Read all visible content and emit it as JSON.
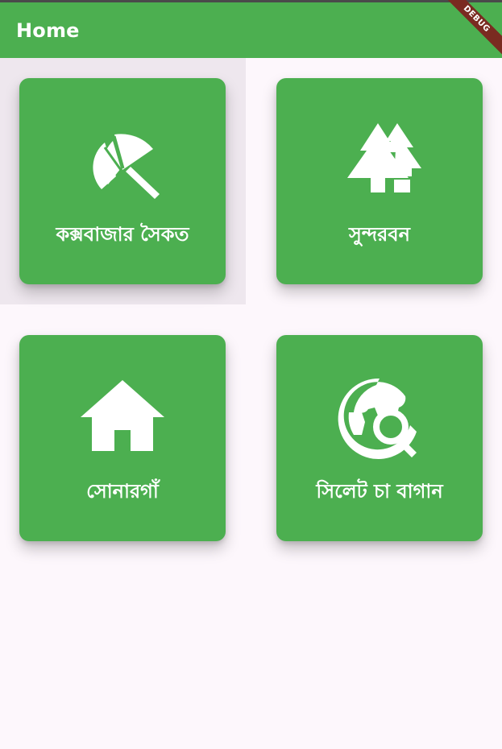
{
  "appbar": {
    "title": "Home",
    "debug_banner": "DEBUG",
    "color": "#4caf50"
  },
  "cards": [
    {
      "label": "কক্সবাজার সৈকত",
      "icon": "beach-umbrella-icon"
    },
    {
      "label": "সুন্দরবন",
      "icon": "forest-icon"
    },
    {
      "label": "সোনারগাঁ",
      "icon": "home-icon"
    },
    {
      "label": "সিলেট চা বাগান",
      "icon": "travel-explore-icon"
    }
  ],
  "colors": {
    "card": "#4caf50",
    "background": "#fdf7fc",
    "highlight": "#eee7ee",
    "debug_ribbon": "#7a2b21"
  }
}
